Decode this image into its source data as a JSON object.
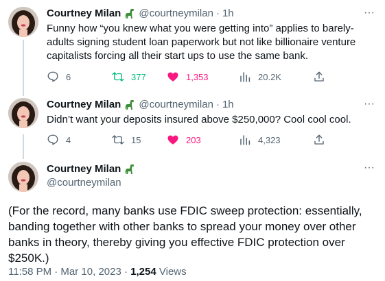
{
  "author": {
    "name": "Courtney Milan",
    "handle": "@courtneymilan",
    "badge_icon": "dinosaur-emoji-icon"
  },
  "colors": {
    "text": "#0f1419",
    "muted": "#536471",
    "retweet_active": "#00ba7c",
    "like_active": "#f91880",
    "thread_line": "#cfd9de"
  },
  "tweets": [
    {
      "time": "1h",
      "text": "Funny how “you knew what you were getting into” applies to barely-adults signing student loan paperwork but not like billionaire venture capitalists forcing all their start ups to use the same bank.",
      "replies": "6",
      "retweets": "377",
      "likes": "1,353",
      "views": "20.2K",
      "retweeted": true,
      "liked": true
    },
    {
      "time": "1h",
      "text": "Didn’t want your deposits insured above $250,000? Cool cool cool.",
      "replies": "4",
      "retweets": "15",
      "likes": "203",
      "views": "4,323",
      "retweeted": false,
      "liked": true
    }
  ],
  "main_tweet": {
    "text": "(For the record, many banks use FDIC sweep protection: essentially, banding together with other banks to spread your money over other banks in theory, thereby giving you effective FDIC protection over $250K.)",
    "timestamp": "11:58 PM · Mar 10, 2023",
    "separator": "·",
    "views_count": "1,254",
    "views_label": "Views"
  },
  "separator_dot": "·",
  "more_glyph": "···"
}
